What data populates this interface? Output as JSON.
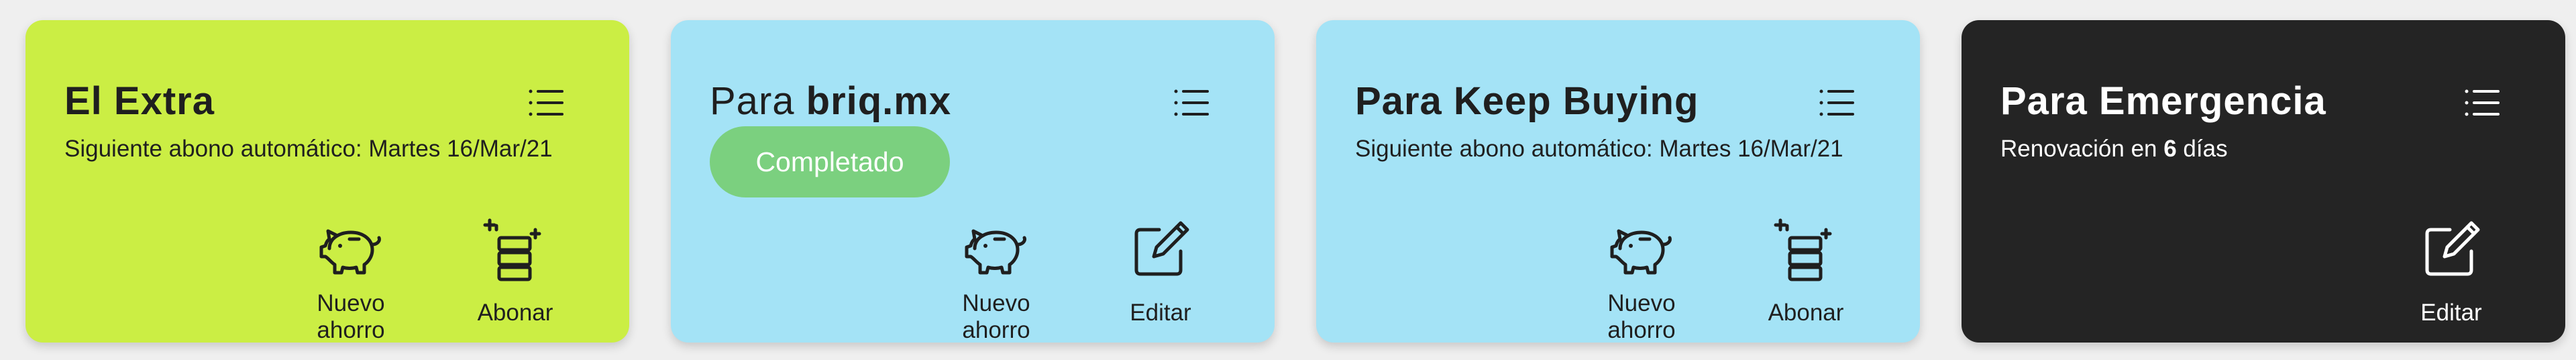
{
  "cards": [
    {
      "title": "El Extra",
      "subtitle": "Siguiente abono automático: Martes 16/Mar/21",
      "bg": "#cbee44",
      "actions": [
        {
          "label": "Nuevo ahorro",
          "icon": "piggy-bank-icon"
        },
        {
          "label": "Abonar",
          "icon": "coins-plus-icon"
        }
      ],
      "menu_icon": "list-menu-icon"
    },
    {
      "title_prefix": "Para ",
      "title_strong": "briq.mx",
      "badge": "Completado",
      "bg": "#a4e3f6",
      "actions": [
        {
          "label": "Nuevo ahorro",
          "icon": "piggy-bank-icon"
        },
        {
          "label": "Editar",
          "icon": "edit-icon"
        }
      ],
      "menu_icon": "list-menu-icon"
    },
    {
      "title": "Para Keep Buying",
      "subtitle": "Siguiente abono automático: Martes 16/Mar/21",
      "bg": "#a4e3f6",
      "actions": [
        {
          "label": "Nuevo ahorro",
          "icon": "piggy-bank-icon"
        },
        {
          "label": "Abonar",
          "icon": "coins-plus-icon"
        }
      ],
      "menu_icon": "list-menu-icon"
    },
    {
      "title": "Para Emergencia",
      "subtitle_prefix": "Renovación en ",
      "subtitle_strong": "6",
      "subtitle_suffix": " días",
      "bg": "#242424",
      "actions": [
        {
          "label": "Editar",
          "icon": "edit-icon"
        }
      ],
      "menu_icon": "list-menu-icon"
    }
  ],
  "colors": {
    "badge_bg": "#7bd07f",
    "dark_text": "#1f1f1f",
    "light_text": "#ffffff"
  }
}
